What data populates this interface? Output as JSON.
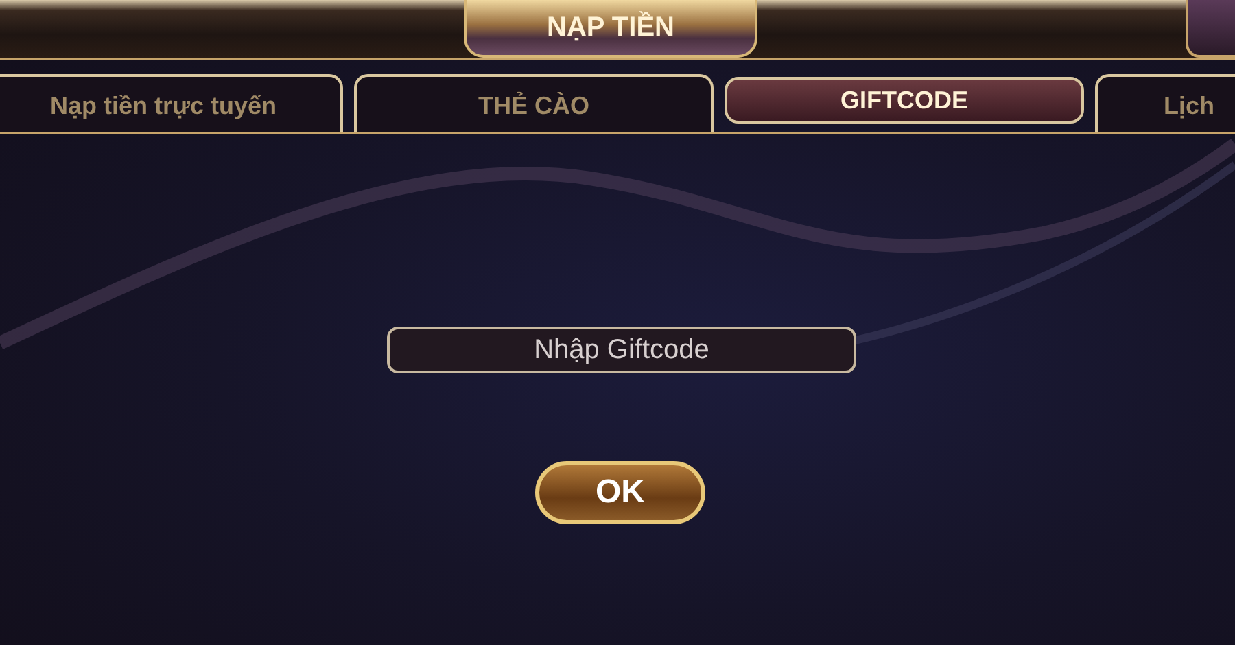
{
  "window": {
    "title": "NẠP TIỀN"
  },
  "tabs": [
    {
      "label": "Nạp tiền trực tuyến",
      "selected": false
    },
    {
      "label": "THẺ CÀO",
      "selected": false
    },
    {
      "label": "GIFTCODE",
      "selected": true
    },
    {
      "label": "Lịch",
      "selected": false
    }
  ],
  "giftcode_field": {
    "placeholder": "Nhập Giftcode"
  },
  "buttons": [
    "OK"
  ]
}
